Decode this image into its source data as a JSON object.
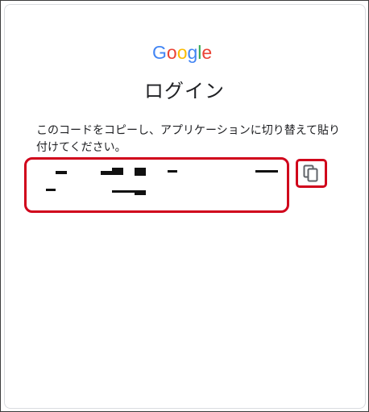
{
  "brand": {
    "logo_text": "Google",
    "colors": {
      "blue": "#4285F4",
      "red": "#EA4335",
      "yellow": "#FBBC05",
      "green": "#34A853"
    }
  },
  "page": {
    "title": "ログイン",
    "instruction": "このコードをコピーし、アプリケーションに切り替えて貼り付けてください。"
  },
  "code": {
    "redacted": true
  },
  "copy_button": {
    "icon": "copy-icon"
  },
  "highlight_color": "#d0021b"
}
